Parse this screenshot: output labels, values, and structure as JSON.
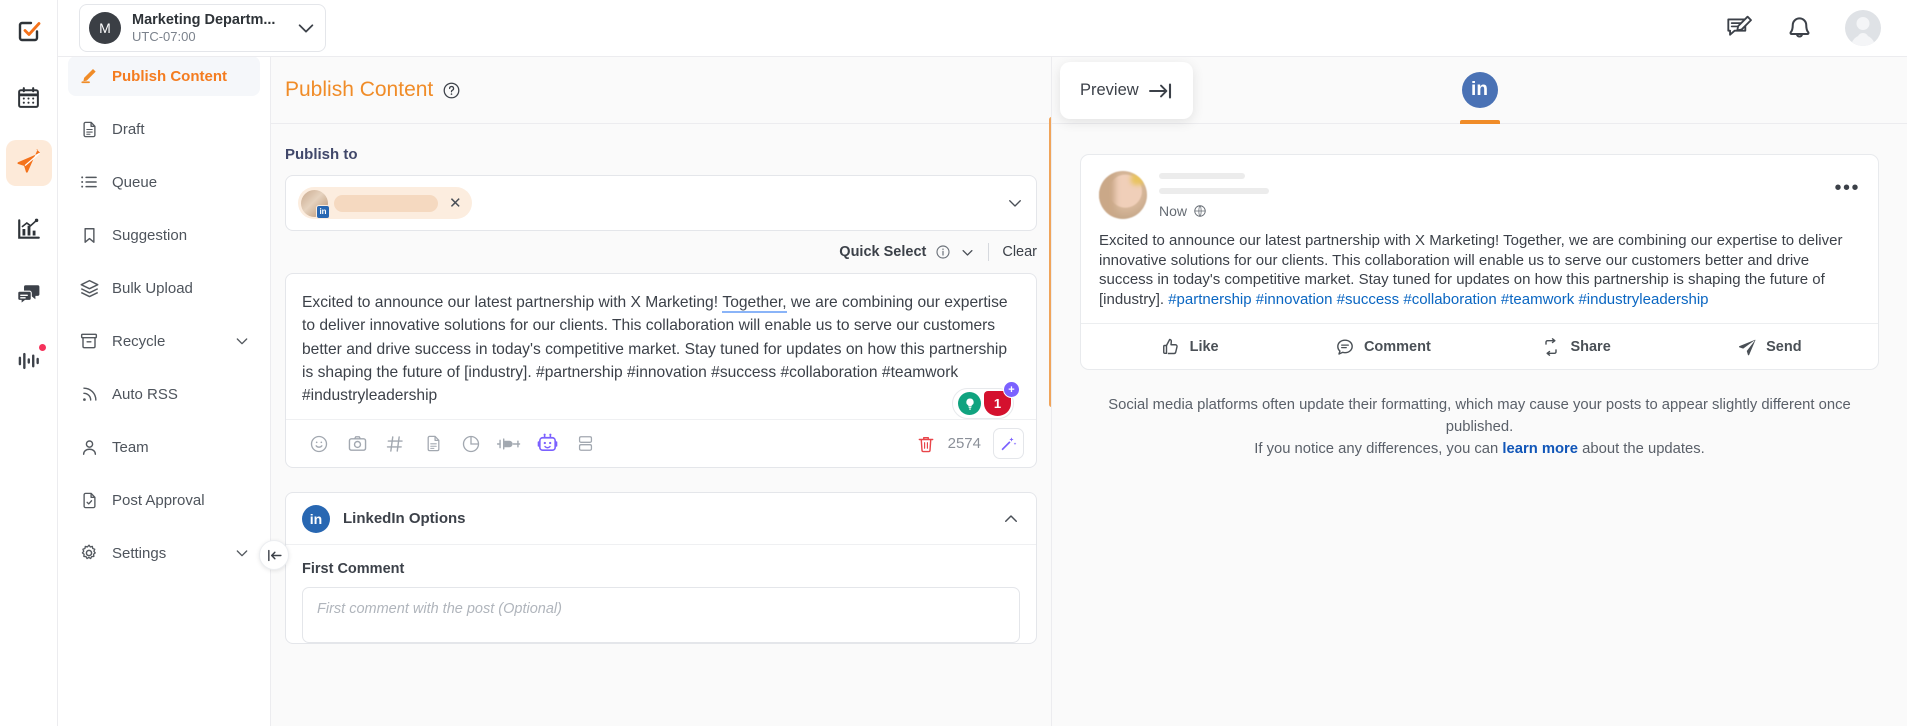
{
  "rail": {
    "items": [
      {
        "name": "checkbox-logo",
        "icon": "logo",
        "active": false,
        "badge": false
      },
      {
        "name": "calendar",
        "icon": "calendar",
        "active": false,
        "badge": false
      },
      {
        "name": "publish",
        "icon": "paper-plane",
        "active": true,
        "badge": false
      },
      {
        "name": "analytics",
        "icon": "chart",
        "active": false,
        "badge": false
      },
      {
        "name": "inbox",
        "icon": "chat",
        "active": false,
        "badge": false
      },
      {
        "name": "monitor",
        "icon": "pulse",
        "active": false,
        "badge": true
      }
    ]
  },
  "workspace": {
    "avatar_initial": "M",
    "name": "Marketing Departm...",
    "timezone": "UTC-07:00"
  },
  "header_icons": {
    "compose": "compose-icon",
    "notifications": "bell-icon",
    "profile": "avatar"
  },
  "sidebar": {
    "items": [
      {
        "label": "Publish Content",
        "icon": "pencil-icon",
        "active": true,
        "chevron": false
      },
      {
        "label": "Draft",
        "icon": "document-icon",
        "active": false,
        "chevron": false
      },
      {
        "label": "Queue",
        "icon": "list-icon",
        "active": false,
        "chevron": false
      },
      {
        "label": "Suggestion",
        "icon": "bookmark-icon",
        "active": false,
        "chevron": false
      },
      {
        "label": "Bulk Upload",
        "icon": "layers-icon",
        "active": false,
        "chevron": false
      },
      {
        "label": "Recycle",
        "icon": "archive-icon",
        "active": false,
        "chevron": true
      },
      {
        "label": "Auto RSS",
        "icon": "rss-icon",
        "active": false,
        "chevron": false
      },
      {
        "label": "Team",
        "icon": "user-icon",
        "active": false,
        "chevron": false
      },
      {
        "label": "Post Approval",
        "icon": "document-check-icon",
        "active": false,
        "chevron": false
      },
      {
        "label": "Settings",
        "icon": "gear-icon",
        "active": false,
        "chevron": true
      }
    ],
    "collapse_icon": "collapse-left-icon"
  },
  "editor": {
    "page_title": "Publish Content",
    "help_icon": "question-mark-icon",
    "publish_to_label": "Publish to",
    "chip": {
      "network": "in",
      "name_redacted": true,
      "remove_icon": "close-icon"
    },
    "quick_select_label": "Quick Select",
    "quick_select_info_icon": "info-icon",
    "quick_select_chevron_icon": "chevron-down-icon",
    "clear_label": "Clear",
    "post_text": "Excited to announce our latest partnership with X Marketing! Together, we are combining our expertise to deliver innovative solutions for our clients. This collaboration will enable us to serve our customers better and drive success in today's competitive market. Stay tuned for updates on how this partnership is shaping the future of [industry]. #partnership #innovation #success #collaboration #teamwork #industryleadership",
    "grammar_underlined_word": "Together,",
    "ai_pill": {
      "bulb_icon": "lightbulb-icon",
      "badge_count": "1",
      "plus_icon": "plus-icon"
    },
    "toolbar_icons": [
      "emoji-icon",
      "camera-icon",
      "hashtag-icon",
      "document-icon",
      "pie-chart-icon",
      "plug-icon",
      "robot-icon",
      "template-icon"
    ],
    "delete_icon": "trash-icon",
    "char_count": "2574",
    "magic_icon": "magic-wand-icon",
    "options": {
      "title": "LinkedIn Options",
      "network_icon": "linkedin-icon",
      "chevron_icon": "chevron-up-icon",
      "first_comment_label": "First Comment",
      "first_comment_placeholder": "First comment with the post (Optional)",
      "first_comment_value": ""
    }
  },
  "preview": {
    "toggle_label": "Preview",
    "toggle_icon": "arrow-right-to-bar-icon",
    "tabs": [
      {
        "network": "linkedin",
        "label": "in",
        "active": true
      }
    ],
    "post": {
      "time": "Now",
      "visibility_icon": "globe-icon",
      "menu_icon": "more-horizontal-icon",
      "body_main": "Excited to announce our latest partnership with X Marketing! Together, we are combining our expertise to deliver innovative solutions for our clients. This collaboration will enable us to serve our customers better and drive success in today's competitive market. Stay tuned for updates on how this partnership is shaping the future of [industry].",
      "hashtags": "#partnership #innovation #success #collaboration #teamwork #industryleadership",
      "actions": [
        {
          "label": "Like",
          "icon": "thumbs-up-icon"
        },
        {
          "label": "Comment",
          "icon": "comment-icon"
        },
        {
          "label": "Share",
          "icon": "share-icon"
        },
        {
          "label": "Send",
          "icon": "send-icon"
        }
      ]
    },
    "note_line1": "Social media platforms often update their formatting, which may cause your",
    "note_line2": "posts to appear slightly different once published.",
    "note_line3_before": "If you notice any differences, you can ",
    "note_link": "learn more",
    "note_line3_after": " about the updates."
  },
  "colors": {
    "accent": "#f08c28",
    "linkedin": "#2867b2",
    "link": "#1156b8",
    "danger": "#d4112e"
  }
}
